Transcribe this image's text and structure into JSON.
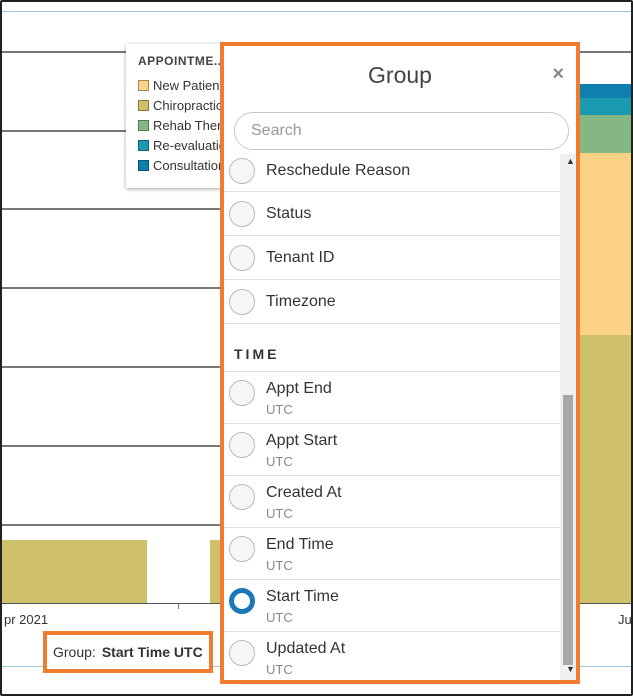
{
  "chart": {
    "x_labels": [
      "pr 2021",
      "Ju"
    ],
    "colors": {
      "olive": "#cfc06a",
      "peach": "#fcd384",
      "green": "#84b783",
      "teal": "#1a9ab0",
      "blue": "#0f7fb0"
    }
  },
  "legend": {
    "title": "APPOINTME...",
    "items": [
      {
        "label": "New Patient",
        "color": "#fcd384"
      },
      {
        "label": "Chiropractic",
        "color": "#cfc06a"
      },
      {
        "label": "Rehab Therapy",
        "color": "#84b783"
      },
      {
        "label": "Re-evaluation",
        "color": "#1a9ab0"
      },
      {
        "label": "Consultation",
        "color": "#0f7fb0"
      }
    ]
  },
  "group_indicator": {
    "label": "Group:",
    "value": "Start Time UTC"
  },
  "panel": {
    "title": "Group",
    "close_icon": "×",
    "search_placeholder": "Search",
    "section_time": "TIME",
    "options_top": [
      "Reschedule Reason",
      "Status",
      "Tenant ID",
      "Timezone"
    ],
    "options_time": [
      {
        "label": "Appt End",
        "sub": "UTC",
        "selected": false
      },
      {
        "label": "Appt Start",
        "sub": "UTC",
        "selected": false
      },
      {
        "label": "Created At",
        "sub": "UTC",
        "selected": false
      },
      {
        "label": "End Time",
        "sub": "UTC",
        "selected": false
      },
      {
        "label": "Start Time",
        "sub": "UTC",
        "selected": true
      },
      {
        "label": "Updated At",
        "sub": "UTC",
        "selected": false
      }
    ]
  },
  "icons": {
    "close": "close-icon",
    "scroll_up": "chevron-up-icon",
    "scroll_down": "chevron-down-icon"
  }
}
